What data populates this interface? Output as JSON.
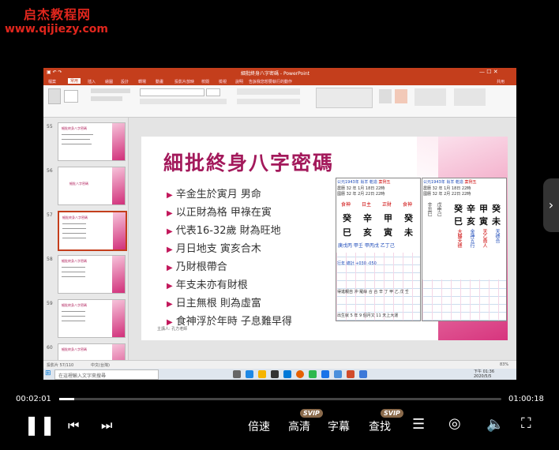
{
  "watermark": {
    "name": "启杰教程网",
    "url": "www.qijiezy.com"
  },
  "app": {
    "title": "細批終身八字密碼 - PowerPoint",
    "tabs": [
      "檔案",
      "常用",
      "插入",
      "繪圖",
      "設計",
      "轉場",
      "動畫",
      "投影片放映",
      "校閱",
      "檢視",
      "說明",
      "告訴我您想要執行的動作"
    ],
    "share": "共用"
  },
  "thumbnails": [
    {
      "num": "55",
      "title": "細批終身八字密碼"
    },
    {
      "num": "56",
      "title": "細批八字密碼"
    },
    {
      "num": "57",
      "title": "細批終身八字密碼"
    },
    {
      "num": "58",
      "title": "細批終身八字密碼"
    },
    {
      "num": "59",
      "title": "細批終身八字密碼"
    },
    {
      "num": "60",
      "title": "細批終身八字密碼"
    }
  ],
  "slide": {
    "title": "細批終身八字密碼",
    "bullets": [
      "辛金生於寅月 男命",
      "以正財為格 甲祿在寅",
      "代表16-32歲 財為旺地",
      "月日地支 寅亥合木",
      "乃財根帶合",
      "年支未亦有財根",
      "日主無根 則為虛富",
      "食神浮於年時 子息難早得"
    ],
    "lecturer": "主講人: 孔方老師",
    "chart_left": {
      "header": "公元1943年 肖羊 乾造",
      "case": "案例五",
      "row1": "農曆 32 年 1月 18日 22時",
      "row2": "國曆 32 年 2月 22日 22時",
      "gods": [
        "食神",
        "日主",
        "正財",
        "食神"
      ],
      "stems": [
        "癸",
        "辛",
        "甲",
        "癸"
      ],
      "branches": [
        "巳",
        "亥",
        "寅",
        "未"
      ],
      "hidden": "庚戊丙 甲壬 甲丙戊 乙丁己",
      "luck": "行年 總計 +030 -050",
      "notes": "得進親自 沖 羅絲 合 合 辛 丁 甲 乙 戊 壬",
      "footer": "出生就 5 年 9 個月又 11 天上大運"
    },
    "chart_right": {
      "header": "公元1943年 肖羊 乾造",
      "case": "案例五",
      "row1": "農曆 32 年 1月 18日 22時",
      "row2": "國曆 32 年 2月 22日 22時",
      "stems": [
        "癸",
        "辛",
        "甲",
        "癸"
      ],
      "branches": [
        "巳",
        "亥",
        "寅",
        "未"
      ],
      "vertical": [
        "辛丑巳",
        "戊申己",
        "大驛天德",
        "金神五行",
        "天乙貴人",
        "天德合"
      ]
    }
  },
  "status": {
    "left": "投影片 57/110",
    "lang": "中文(台灣)",
    "zoom": "83%"
  },
  "taskbar": {
    "search": "在這裡輸入文字來搜尋",
    "time": "下午 01:36",
    "date": "2020/5/5"
  },
  "player": {
    "current": "00:02:01",
    "total": "01:00:18",
    "progress": 0.034,
    "speed": "倍速",
    "quality": "高清",
    "subtitle": "字幕",
    "search": "查找",
    "svip": "SVIP"
  }
}
